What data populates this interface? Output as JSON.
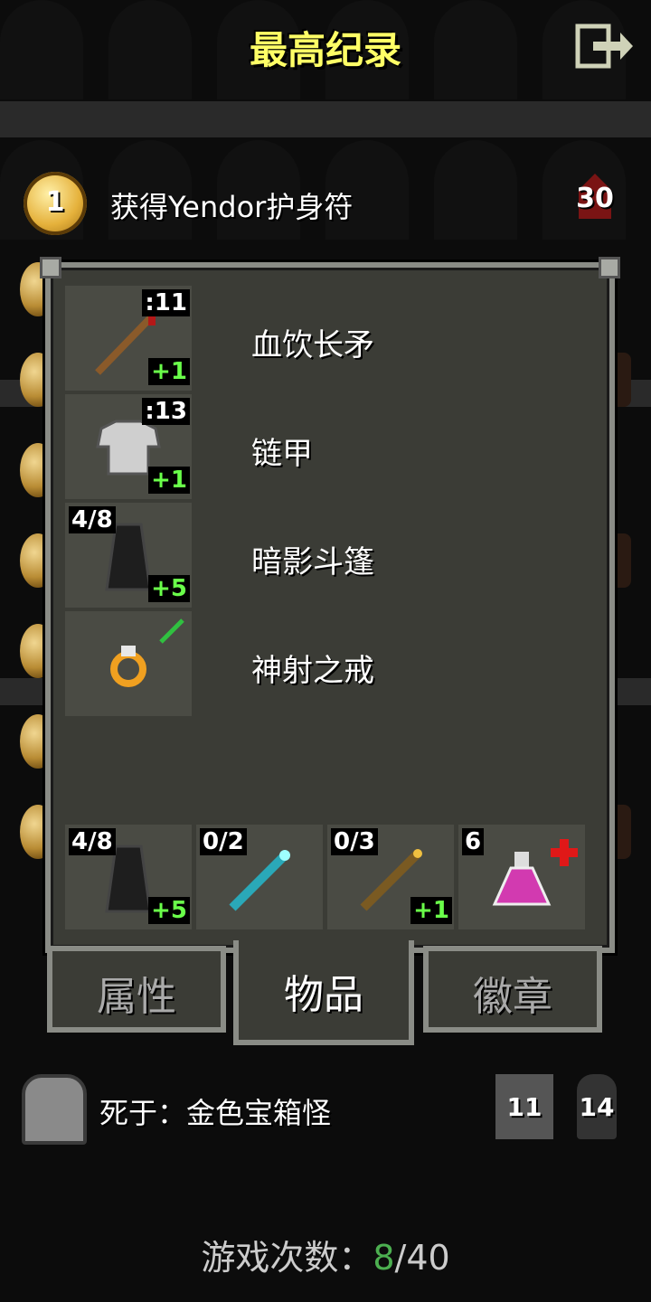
{
  "header": {
    "title": "最高纪录"
  },
  "top_record": {
    "rank": "1",
    "text": "获得Yendor护身符",
    "depth": "30"
  },
  "equipped": [
    {
      "top_right": ":11",
      "bottom_right": "+1",
      "name": "血饮长矛",
      "icon": "spear-icon"
    },
    {
      "top_right": ":13",
      "bottom_right": "+1",
      "name": "链甲",
      "icon": "chainmail-icon"
    },
    {
      "top_left": "4/8",
      "bottom_right": "+5",
      "name": "暗影斗篷",
      "icon": "cloak-icon"
    },
    {
      "name": "神射之戒",
      "icon": "ring-icon"
    }
  ],
  "quickslots": [
    {
      "top_left": "4/8",
      "bottom_right": "+5",
      "icon": "cloak-icon"
    },
    {
      "top_left": "0/2",
      "icon": "wand-icon"
    },
    {
      "top_left": "0/3",
      "bottom_right": "+1",
      "icon": "wand-icon"
    },
    {
      "top_left": "6",
      "icon": "potion-icon"
    }
  ],
  "tabs": {
    "stats": "属性",
    "items": "物品",
    "badges": "徽章"
  },
  "footer": {
    "death_text": "死于：金色宝箱怪",
    "badge_a": "11",
    "badge_b": "14",
    "games_label": "游戏次数：",
    "games_current": "8",
    "games_total": "/40"
  },
  "colors": {
    "title": "#ffff66",
    "upgrade": "#6aff4a",
    "games_current": "#4caf50"
  }
}
